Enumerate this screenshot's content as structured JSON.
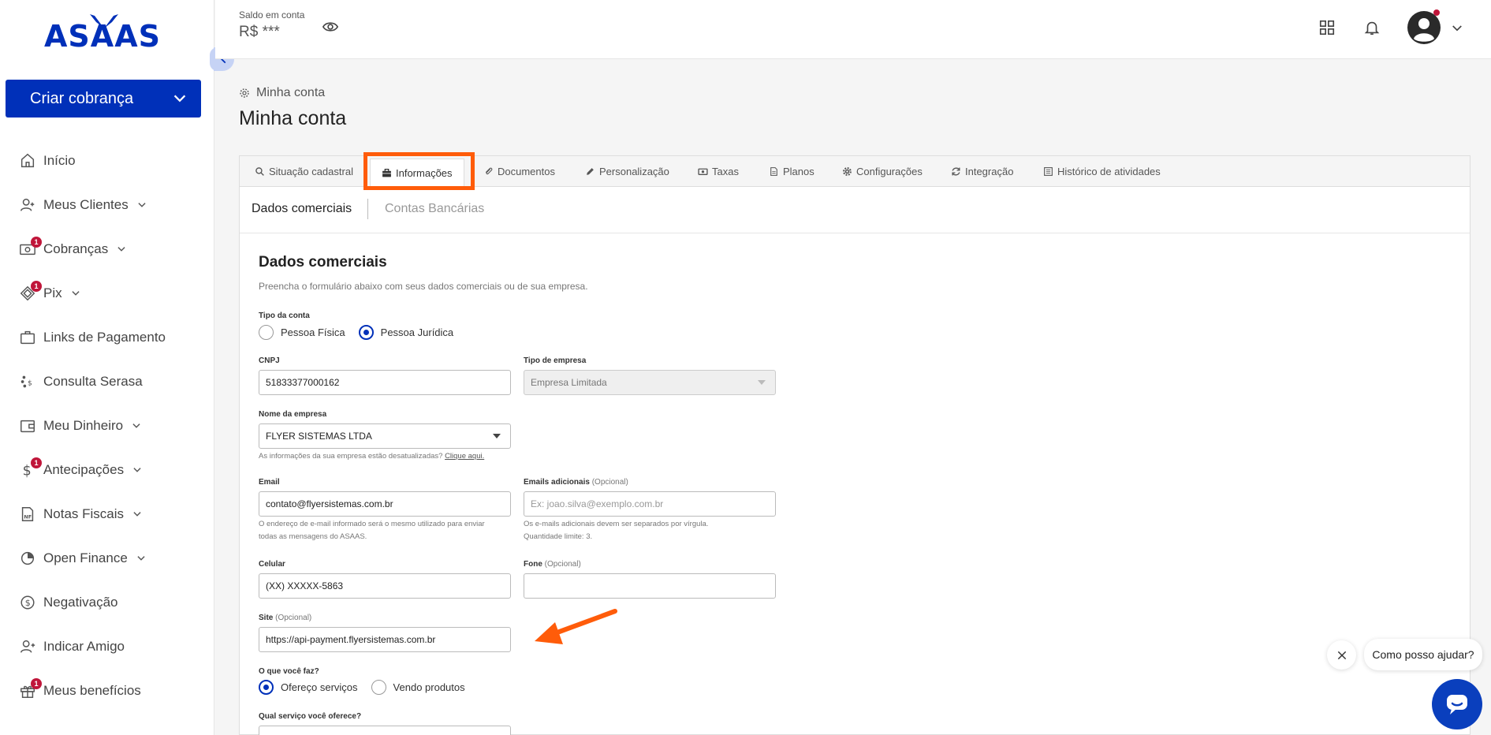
{
  "brand": {
    "logo_text": "ASAAS",
    "primary_color": "#0030b9",
    "accent_highlight": "#ff5c0a"
  },
  "sidebar": {
    "create_button": "Criar cobrança",
    "items": [
      {
        "label": "Início",
        "icon": "home-icon",
        "badge": null,
        "dropdown": false
      },
      {
        "label": "Meus Clientes",
        "icon": "users-icon",
        "badge": null,
        "dropdown": true
      },
      {
        "label": "Cobranças",
        "icon": "money-icon",
        "badge": "1",
        "dropdown": true
      },
      {
        "label": "Pix",
        "icon": "pix-icon",
        "badge": "1",
        "dropdown": true
      },
      {
        "label": "Links de Pagamento",
        "icon": "briefcase-icon",
        "badge": null,
        "dropdown": false
      },
      {
        "label": "Consulta Serasa",
        "icon": "serasa-icon",
        "badge": null,
        "dropdown": false
      },
      {
        "label": "Meu Dinheiro",
        "icon": "wallet-icon",
        "badge": null,
        "dropdown": true
      },
      {
        "label": "Antecipações",
        "icon": "dollar-icon",
        "badge": "1",
        "dropdown": true
      },
      {
        "label": "Notas Fiscais",
        "icon": "invoice-icon",
        "badge": null,
        "dropdown": true
      },
      {
        "label": "Open Finance",
        "icon": "pie-chart-icon",
        "badge": null,
        "dropdown": true
      },
      {
        "label": "Negativação",
        "icon": "coin-icon",
        "badge": null,
        "dropdown": false
      },
      {
        "label": "Indicar Amigo",
        "icon": "add-user-icon",
        "badge": null,
        "dropdown": false
      },
      {
        "label": "Meus benefícios",
        "icon": "gift-icon",
        "badge": "1",
        "dropdown": false
      }
    ]
  },
  "header": {
    "balance_label": "Saldo em conta",
    "balance_value": "R$ ***"
  },
  "page": {
    "breadcrumb": "Minha conta",
    "title": "Minha conta"
  },
  "tabs": [
    {
      "label": "Situação cadastral",
      "icon": "search-icon"
    },
    {
      "label": "Informações",
      "icon": "briefcase-icon",
      "active": true
    },
    {
      "label": "Documentos",
      "icon": "paperclip-icon"
    },
    {
      "label": "Personalização",
      "icon": "pencil-icon"
    },
    {
      "label": "Taxas",
      "icon": "money-icon"
    },
    {
      "label": "Planos",
      "icon": "file-icon"
    },
    {
      "label": "Configurações",
      "icon": "gear-icon"
    },
    {
      "label": "Integração",
      "icon": "refresh-icon"
    },
    {
      "label": "Histórico de atividades",
      "icon": "list-icon"
    }
  ],
  "subtabs": {
    "active": "Dados comerciais",
    "other": "Contas Bancárias"
  },
  "form": {
    "title": "Dados comerciais",
    "description": "Preencha o formulário abaixo com seus dados comerciais ou de sua empresa.",
    "account_type": {
      "label": "Tipo da conta",
      "options": [
        "Pessoa Física",
        "Pessoa Jurídica"
      ],
      "selected": "Pessoa Jurídica"
    },
    "cnpj": {
      "label": "CNPJ",
      "value": "51833377000162"
    },
    "company_type": {
      "label": "Tipo de empresa",
      "value": "Empresa Limitada"
    },
    "company_name": {
      "label": "Nome da empresa",
      "value": "FLYER SISTEMAS LTDA",
      "help": "As informações da sua empresa estão desatualizadas?",
      "help_link": "Clique aqui."
    },
    "email": {
      "label": "Email",
      "value": "contato@flyersistemas.com.br",
      "help_line1": "O endereço de e-mail informado será o mesmo utilizado para enviar",
      "help_line2": "todas as mensagens do ASAAS."
    },
    "extra_emails": {
      "label": "Emails adicionais",
      "optional": "(Opcional)",
      "placeholder": "Ex: joao.silva@exemplo.com.br",
      "help_line1": "Os e-mails adicionais devem ser separados por vírgula.",
      "help_line2": "Quantidade limite: 3."
    },
    "mobile": {
      "label": "Celular",
      "value": "(XX) XXXXX-5863"
    },
    "phone": {
      "label": "Fone",
      "optional": "(Opcional)",
      "value": ""
    },
    "site": {
      "label": "Site",
      "optional": "(Opcional)",
      "value": "https://api-payment.flyersistemas.com.br"
    },
    "what_you_do": {
      "label": "O que você faz?",
      "options": [
        "Ofereço serviços",
        "Vendo produtos"
      ],
      "selected": "Ofereço serviços"
    },
    "service_question": {
      "label": "Qual serviço você oferece?"
    }
  },
  "chat": {
    "prompt": "Como posso ajudar?"
  }
}
